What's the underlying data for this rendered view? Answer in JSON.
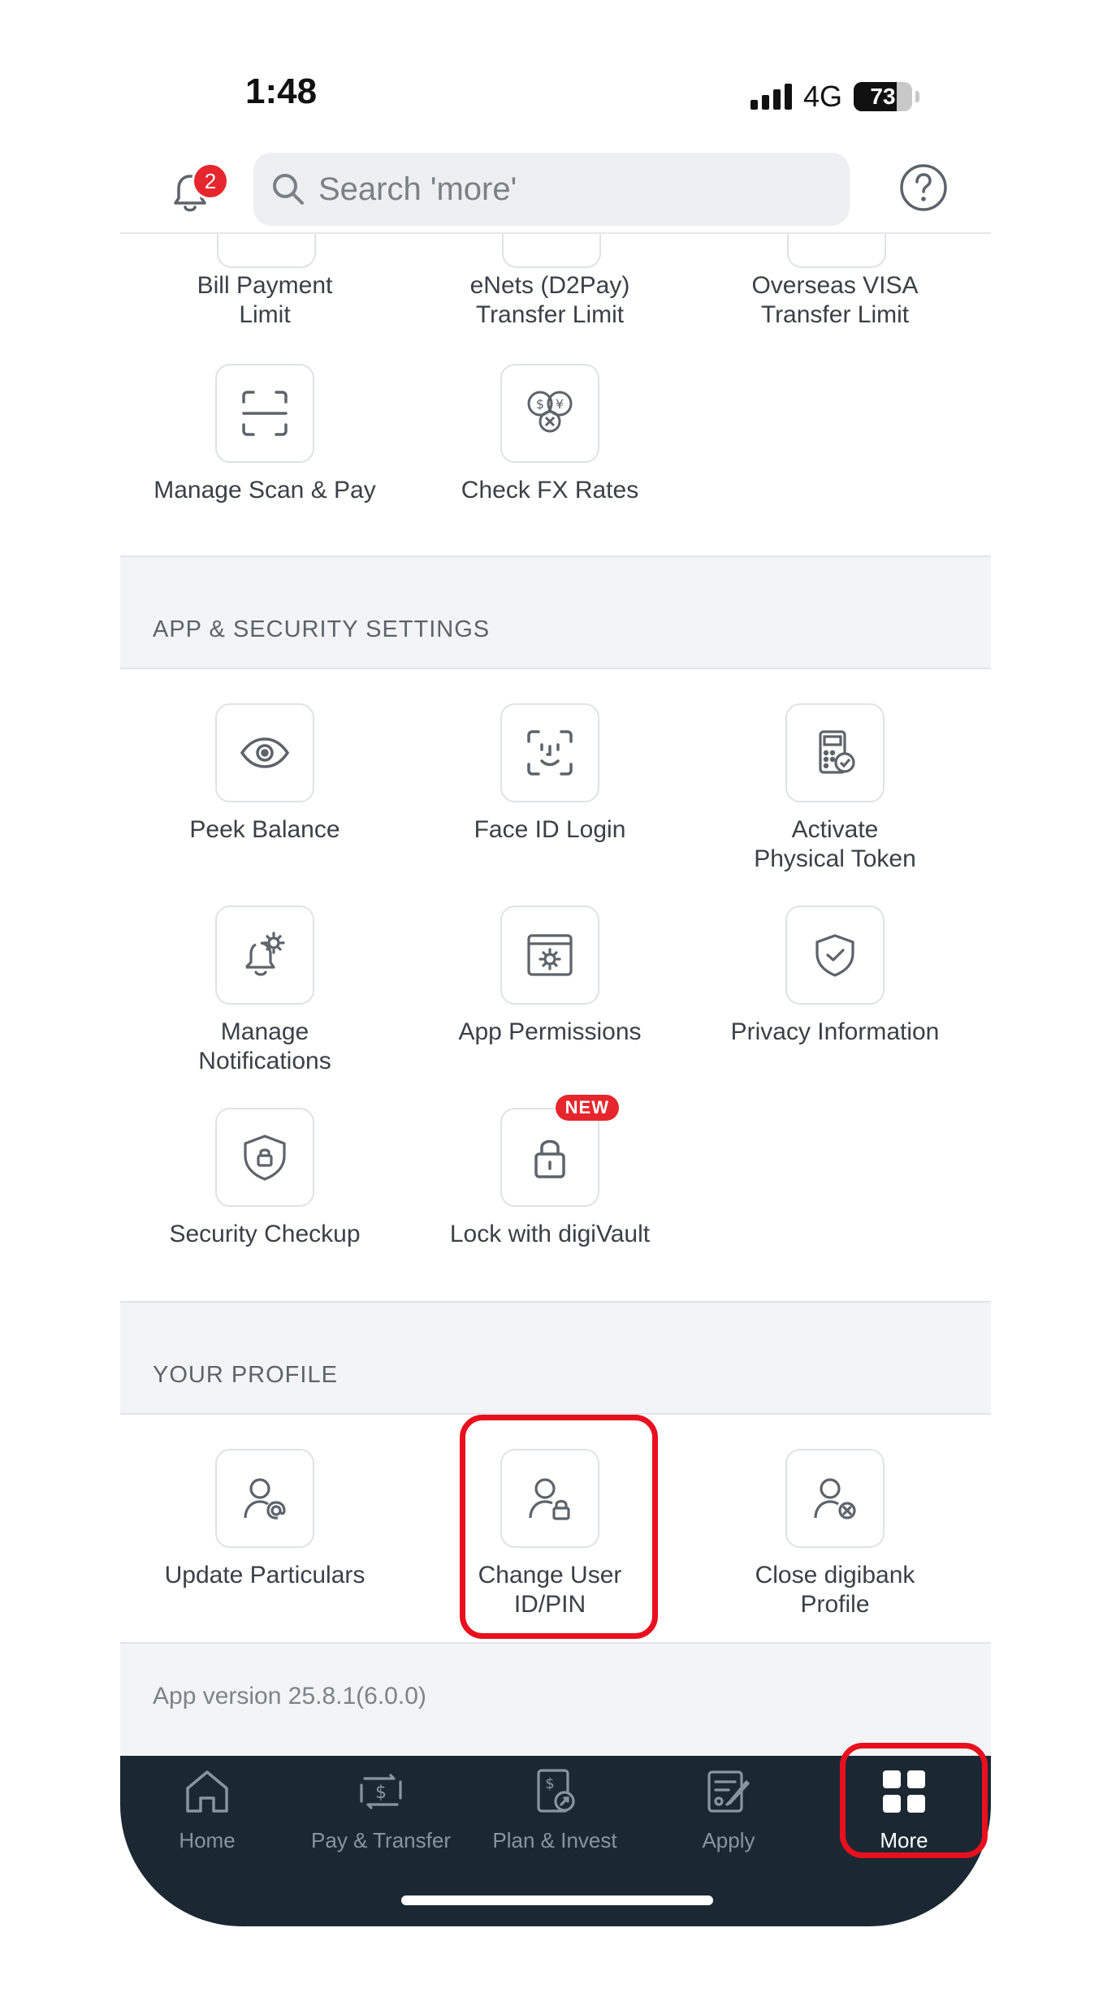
{
  "status_bar": {
    "time": "1:48",
    "network": "4G",
    "battery": "73"
  },
  "header": {
    "notification_count": "2",
    "search_placeholder": "Search 'more'"
  },
  "limits_row": {
    "items": [
      {
        "label_line1": "Bill Payment",
        "label_line2": "Limit"
      },
      {
        "label_line1": "eNets (D2Pay)",
        "label_line2": "Transfer Limit"
      },
      {
        "label_line1": "Overseas VISA",
        "label_line2": "Transfer Limit"
      }
    ]
  },
  "payments_row": {
    "items": [
      {
        "label": "Manage Scan & Pay",
        "icon": "scan-icon"
      },
      {
        "label": "Check FX Rates",
        "icon": "fx-rates-icon"
      }
    ]
  },
  "app_security": {
    "title": "APP & SECURITY SETTINGS",
    "items": [
      {
        "label_line1": "Peek Balance",
        "label_line2": "",
        "icon": "eye-icon"
      },
      {
        "label_line1": "Face ID Login",
        "label_line2": "",
        "icon": "face-id-icon"
      },
      {
        "label_line1": "Activate",
        "label_line2": "Physical Token",
        "icon": "token-icon"
      },
      {
        "label_line1": "Manage",
        "label_line2": "Notifications",
        "icon": "bell-gear-icon"
      },
      {
        "label_line1": "App Permissions",
        "label_line2": "",
        "icon": "permissions-icon"
      },
      {
        "label_line1": "Privacy Information",
        "label_line2": "",
        "icon": "shield-check-icon"
      },
      {
        "label_line1": "Security Checkup",
        "label_line2": "",
        "icon": "shield-lock-icon"
      },
      {
        "label_line1": "Lock with digiVault",
        "label_line2": "",
        "icon": "lock-icon",
        "badge": "NEW"
      }
    ]
  },
  "profile": {
    "title": "YOUR PROFILE",
    "items": [
      {
        "label_line1": "Update Particulars",
        "label_line2": "",
        "icon": "user-at-icon"
      },
      {
        "label_line1": "Change User",
        "label_line2": "ID/PIN",
        "icon": "user-lock-icon"
      },
      {
        "label_line1": "Close digibank",
        "label_line2": "Profile",
        "icon": "user-x-icon"
      }
    ]
  },
  "footer": {
    "version": "App version 25.8.1(6.0.0)"
  },
  "bottom_nav": {
    "items": [
      {
        "label": "Home",
        "icon": "home-icon"
      },
      {
        "label": "Pay & Transfer",
        "icon": "pay-transfer-icon"
      },
      {
        "label": "Plan & Invest",
        "icon": "plan-invest-icon"
      },
      {
        "label": "Apply",
        "icon": "apply-icon"
      },
      {
        "label": "More",
        "icon": "grid-icon",
        "active": true
      }
    ]
  },
  "colors": {
    "accent_red": "#e6262d",
    "nav_background": "#1b2733",
    "highlight": "#e8101e"
  }
}
